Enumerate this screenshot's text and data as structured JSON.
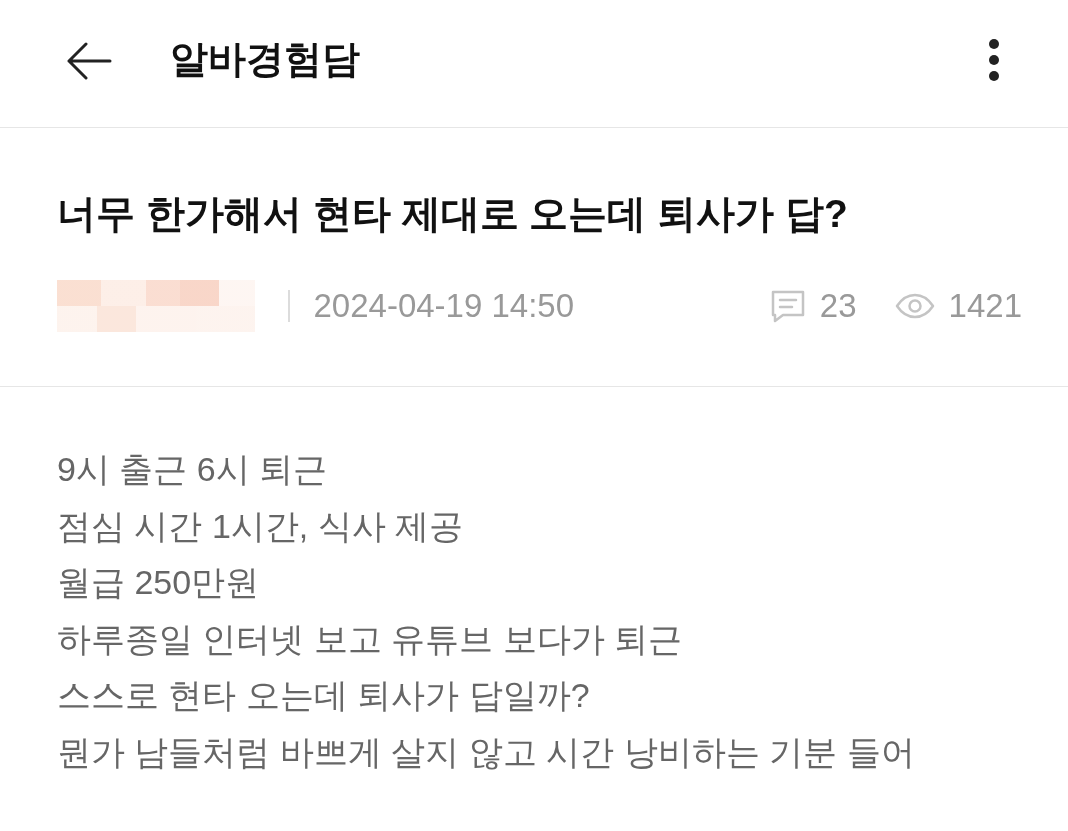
{
  "header": {
    "title": "알바경험담"
  },
  "post": {
    "title": "너무 한가해서 현타 제대로 오는데 퇴사가 답?",
    "date": "2024-04-19 14:50",
    "comment_count": "23",
    "view_count": "1421"
  },
  "body": {
    "lines": [
      "9시 출근 6시 퇴근",
      "점심 시간 1시간, 식사 제공",
      "월급 250만원",
      "하루종일 인터넷 보고 유튜브 보다가 퇴근",
      "스스로 현타 오는데 퇴사가 답일까?",
      "뭔가 남들처럼 바쁘게 살지 않고 시간 낭비하는 기분 들어"
    ]
  }
}
